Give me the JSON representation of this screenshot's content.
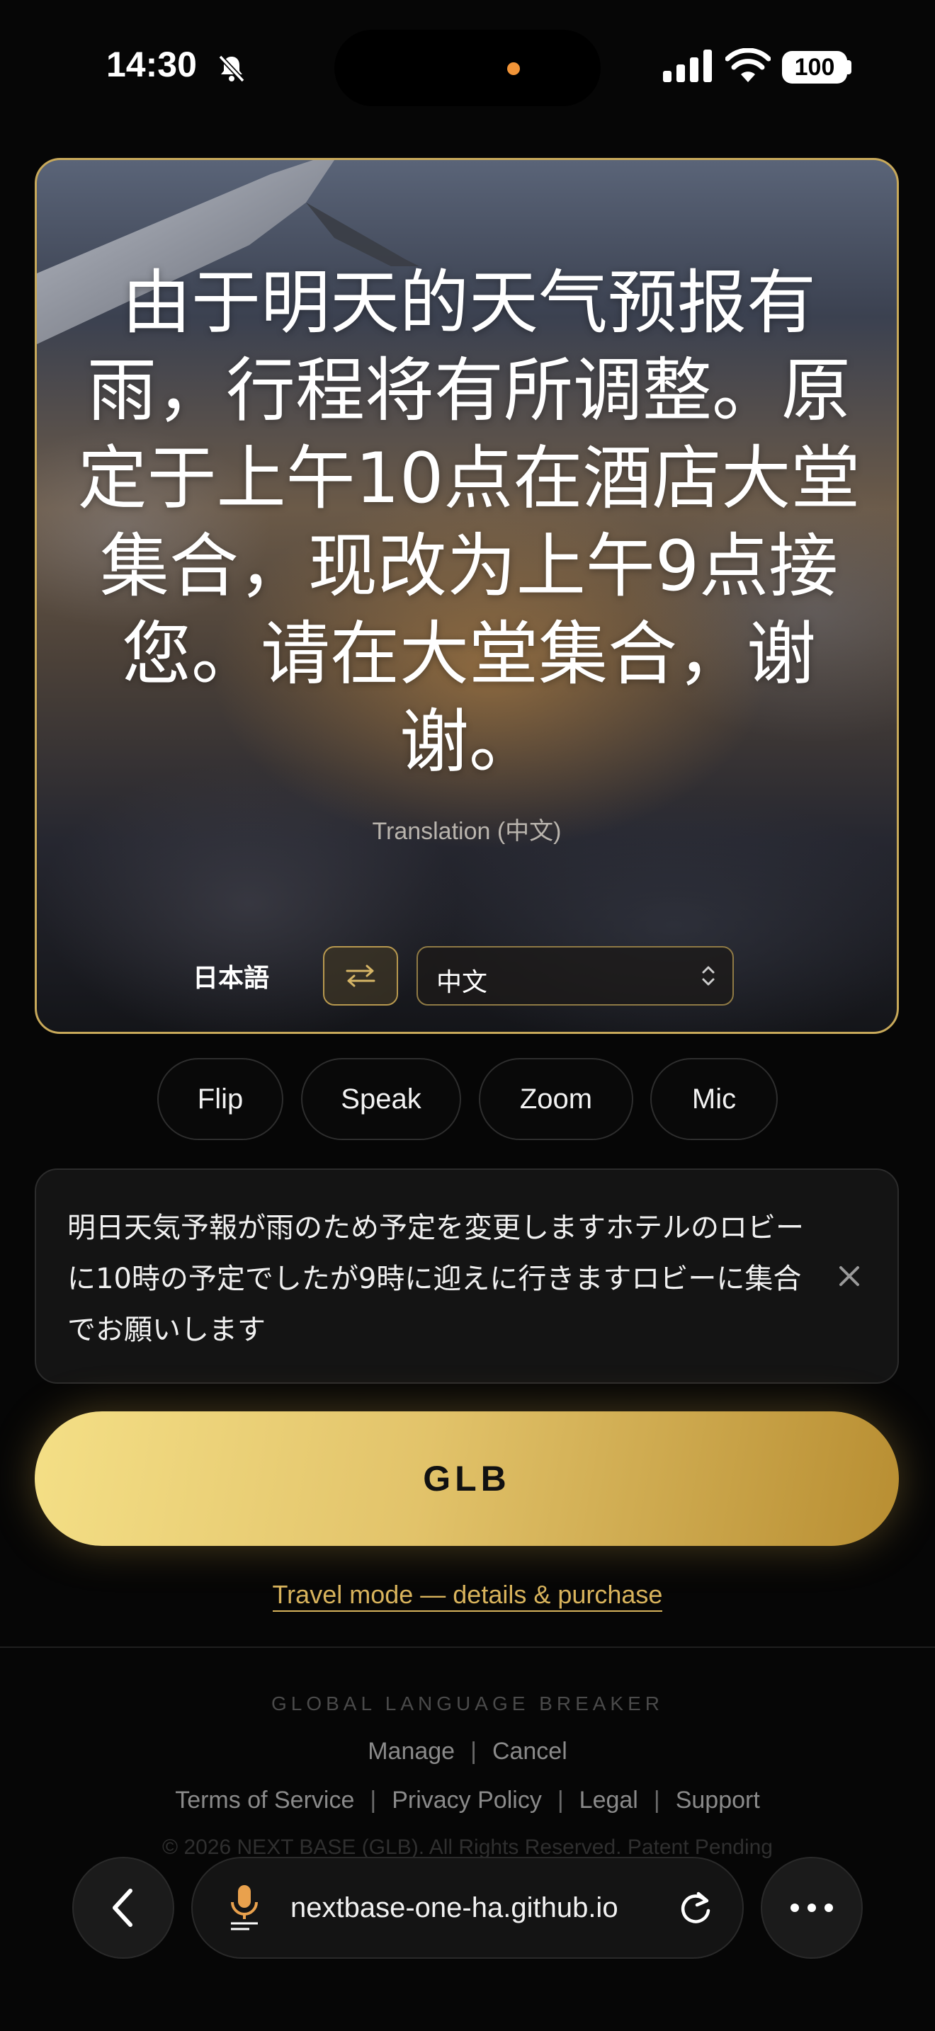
{
  "status_bar": {
    "time": "14:30",
    "battery": "100",
    "icons": [
      "bell-slash-icon",
      "cellular-signal-icon",
      "wifi-icon",
      "battery-icon"
    ]
  },
  "hero": {
    "translated_text": "由于明天的天气预报有雨，行程将有所调整。原定于上午10点在酒店大堂集合，现改为上午9点接您。请在大堂集合，谢谢。",
    "caption": "Translation (中文)",
    "source_language": "日本語",
    "target_language": "中文",
    "swap_icon": "swap-arrows-icon",
    "border_color": "#c8a95a"
  },
  "actions": {
    "flip": "Flip",
    "speak": "Speak",
    "zoom": "Zoom",
    "mic": "Mic"
  },
  "source_input": {
    "text": "明日天気予報が雨のため予定を変更しますホテルのロビーに10時の予定でしたが9時に迎えに行きますロビーに集合でお願いします",
    "clear_icon": "close-icon"
  },
  "main_button": {
    "label": "GLB",
    "color": "#e2c36a"
  },
  "travel_link": "Travel mode — details & purchase",
  "footer": {
    "brand": "GLOBAL LANGUAGE BREAKER",
    "manage": "Manage",
    "cancel": "Cancel",
    "separator": "|",
    "terms": "Terms of Service",
    "privacy": "Privacy Policy",
    "legal": "Legal",
    "support": "Support",
    "copyright": "© 2026 NEXT BASE (GLB). All Rights Reserved. Patent Pending"
  },
  "browser": {
    "url": "nextbase-one-ha.github.io",
    "icons": [
      "back-chevron-icon",
      "microphone-icon",
      "reload-icon",
      "more-icon"
    ]
  },
  "accent_color": "#d8b35c"
}
